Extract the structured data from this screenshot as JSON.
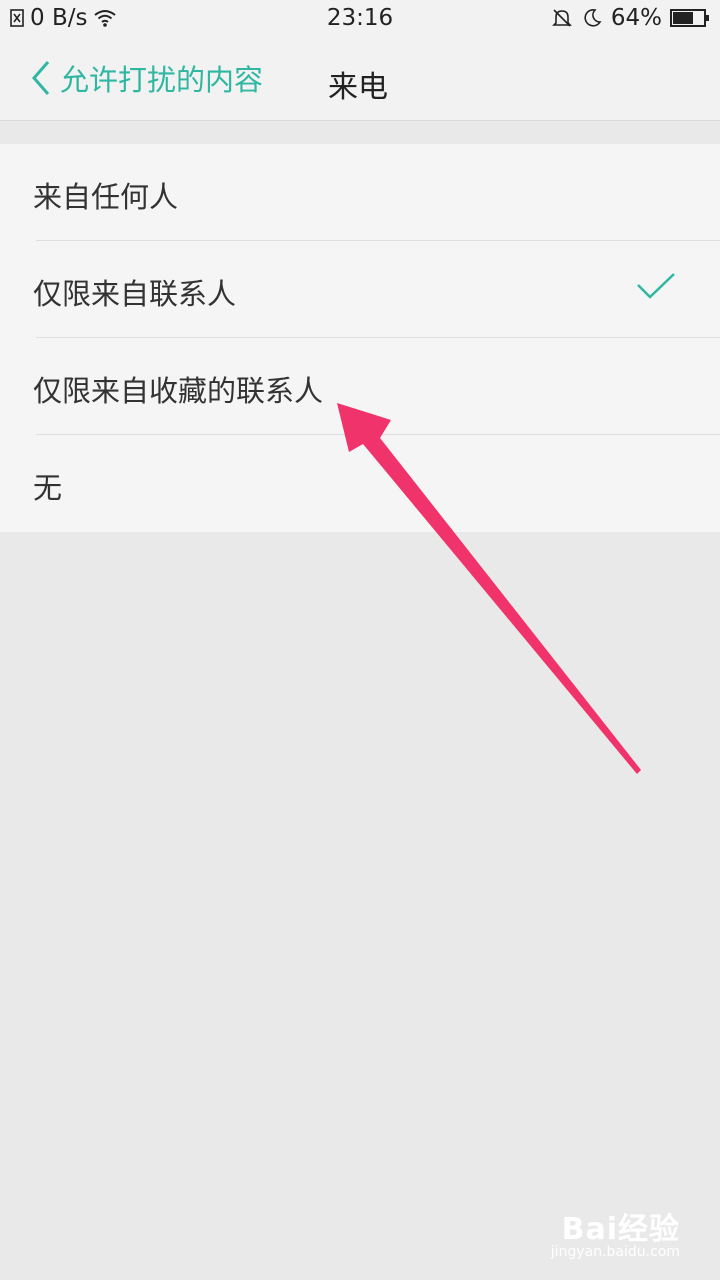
{
  "status_bar": {
    "net_speed": "0 B/s",
    "time": "23:16",
    "battery": "64%"
  },
  "app_bar": {
    "back_label": "允许打扰的内容",
    "title": "来电"
  },
  "options": [
    {
      "label": "来自任何人",
      "selected": false
    },
    {
      "label": "仅限来自联系人",
      "selected": true
    },
    {
      "label": "仅限来自收藏的联系人",
      "selected": false
    },
    {
      "label": "无",
      "selected": false
    }
  ],
  "colors": {
    "accent": "#2fb7a2",
    "annotation": "#f0336b"
  },
  "watermark": {
    "brand": "Bai经验",
    "url": "jingyan.baidu.com"
  }
}
